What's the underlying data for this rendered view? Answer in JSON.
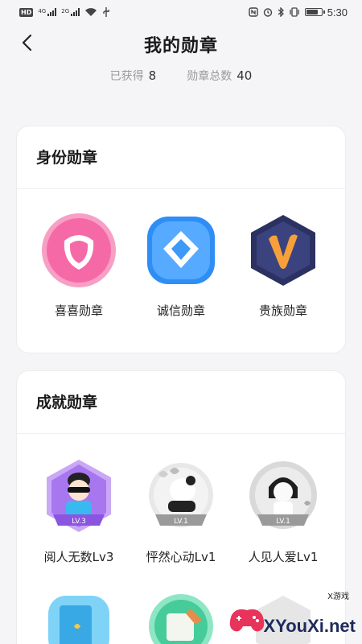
{
  "status_bar": {
    "hd": "HD",
    "signal1": "4G",
    "signal2": "2G",
    "time": "5:30",
    "battery_level": 0.85
  },
  "header": {
    "title": "我的勋章",
    "back_icon": "chevron-left-icon"
  },
  "stats": {
    "earned_label": "已获得",
    "earned_value": "8",
    "total_label": "勋章总数",
    "total_value": "40"
  },
  "identity_section": {
    "title": "身份勋章",
    "badges": [
      {
        "label": "喜喜勋章",
        "icon": "pink-shield-badge-icon"
      },
      {
        "label": "诚信勋章",
        "icon": "blue-diamond-badge-icon"
      },
      {
        "label": "贵族勋章",
        "icon": "v-hexagon-badge-icon"
      }
    ]
  },
  "achievement_section": {
    "title": "成就勋章",
    "badges": [
      {
        "label": "阅人无数Lv3",
        "level": "LV.3",
        "icon": "cool-character-badge-icon"
      },
      {
        "label": "怦然心动Lv1",
        "level": "LV.1",
        "icon": "panda-hearts-badge-icon"
      },
      {
        "label": "人见人爱Lv1",
        "level": "LV.1",
        "icon": "girl-hearts-badge-icon"
      }
    ],
    "row2_badges": [
      {
        "icon": "blue-book-badge-icon"
      },
      {
        "icon": "green-letter-badge-icon"
      },
      {
        "icon": "locked-badge-icon"
      }
    ]
  },
  "watermark": {
    "text": "XYouXi.net",
    "sub": "X游戏"
  }
}
